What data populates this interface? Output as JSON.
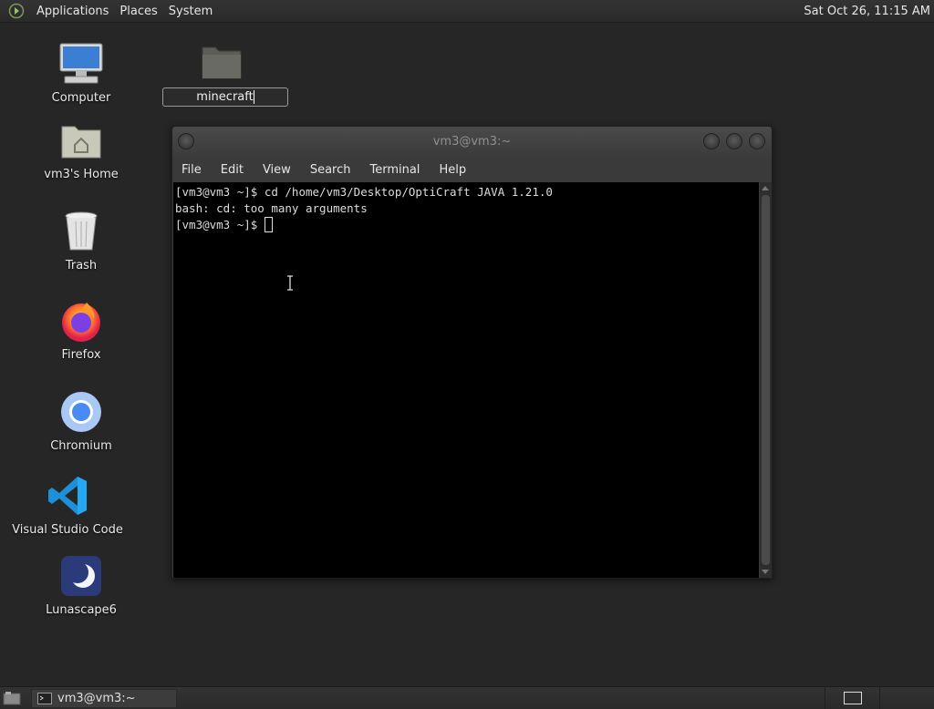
{
  "top_panel": {
    "menus": [
      "Applications",
      "Places",
      "System"
    ],
    "clock": "Sat Oct 26, 11:15 AM"
  },
  "desktop": {
    "icons": [
      {
        "label": "Computer",
        "icon": "computer-icon"
      },
      {
        "label": "vm3's Home",
        "icon": "home-folder-icon"
      },
      {
        "label": "Trash",
        "icon": "trash-icon"
      },
      {
        "label": "Firefox",
        "icon": "firefox-icon"
      },
      {
        "label": "Chromium",
        "icon": "chromium-icon"
      },
      {
        "label": "Visual Studio Code",
        "icon": "vscode-icon"
      },
      {
        "label": "Lunascape6",
        "icon": "lunascape-icon"
      }
    ],
    "folder": {
      "name": "minecraft",
      "icon": "folder-icon"
    }
  },
  "terminal": {
    "title": "vm3@vm3:~",
    "menu": [
      "File",
      "Edit",
      "View",
      "Search",
      "Terminal",
      "Help"
    ],
    "lines": [
      "[vm3@vm3 ~]$ cd /home/vm3/Desktop/OptiCraft JAVA 1.21.0",
      "bash: cd: too many arguments"
    ],
    "prompt": "[vm3@vm3 ~]$ "
  },
  "taskbar": {
    "task_label": "vm3@vm3:~"
  },
  "colors": {
    "desktop_bg": "#262626",
    "panel_bg": "#2e2e2e",
    "terminal_bg": "#000000",
    "vscode_blue": "#23a9f2",
    "chromium_blue": "#4a8af4"
  }
}
